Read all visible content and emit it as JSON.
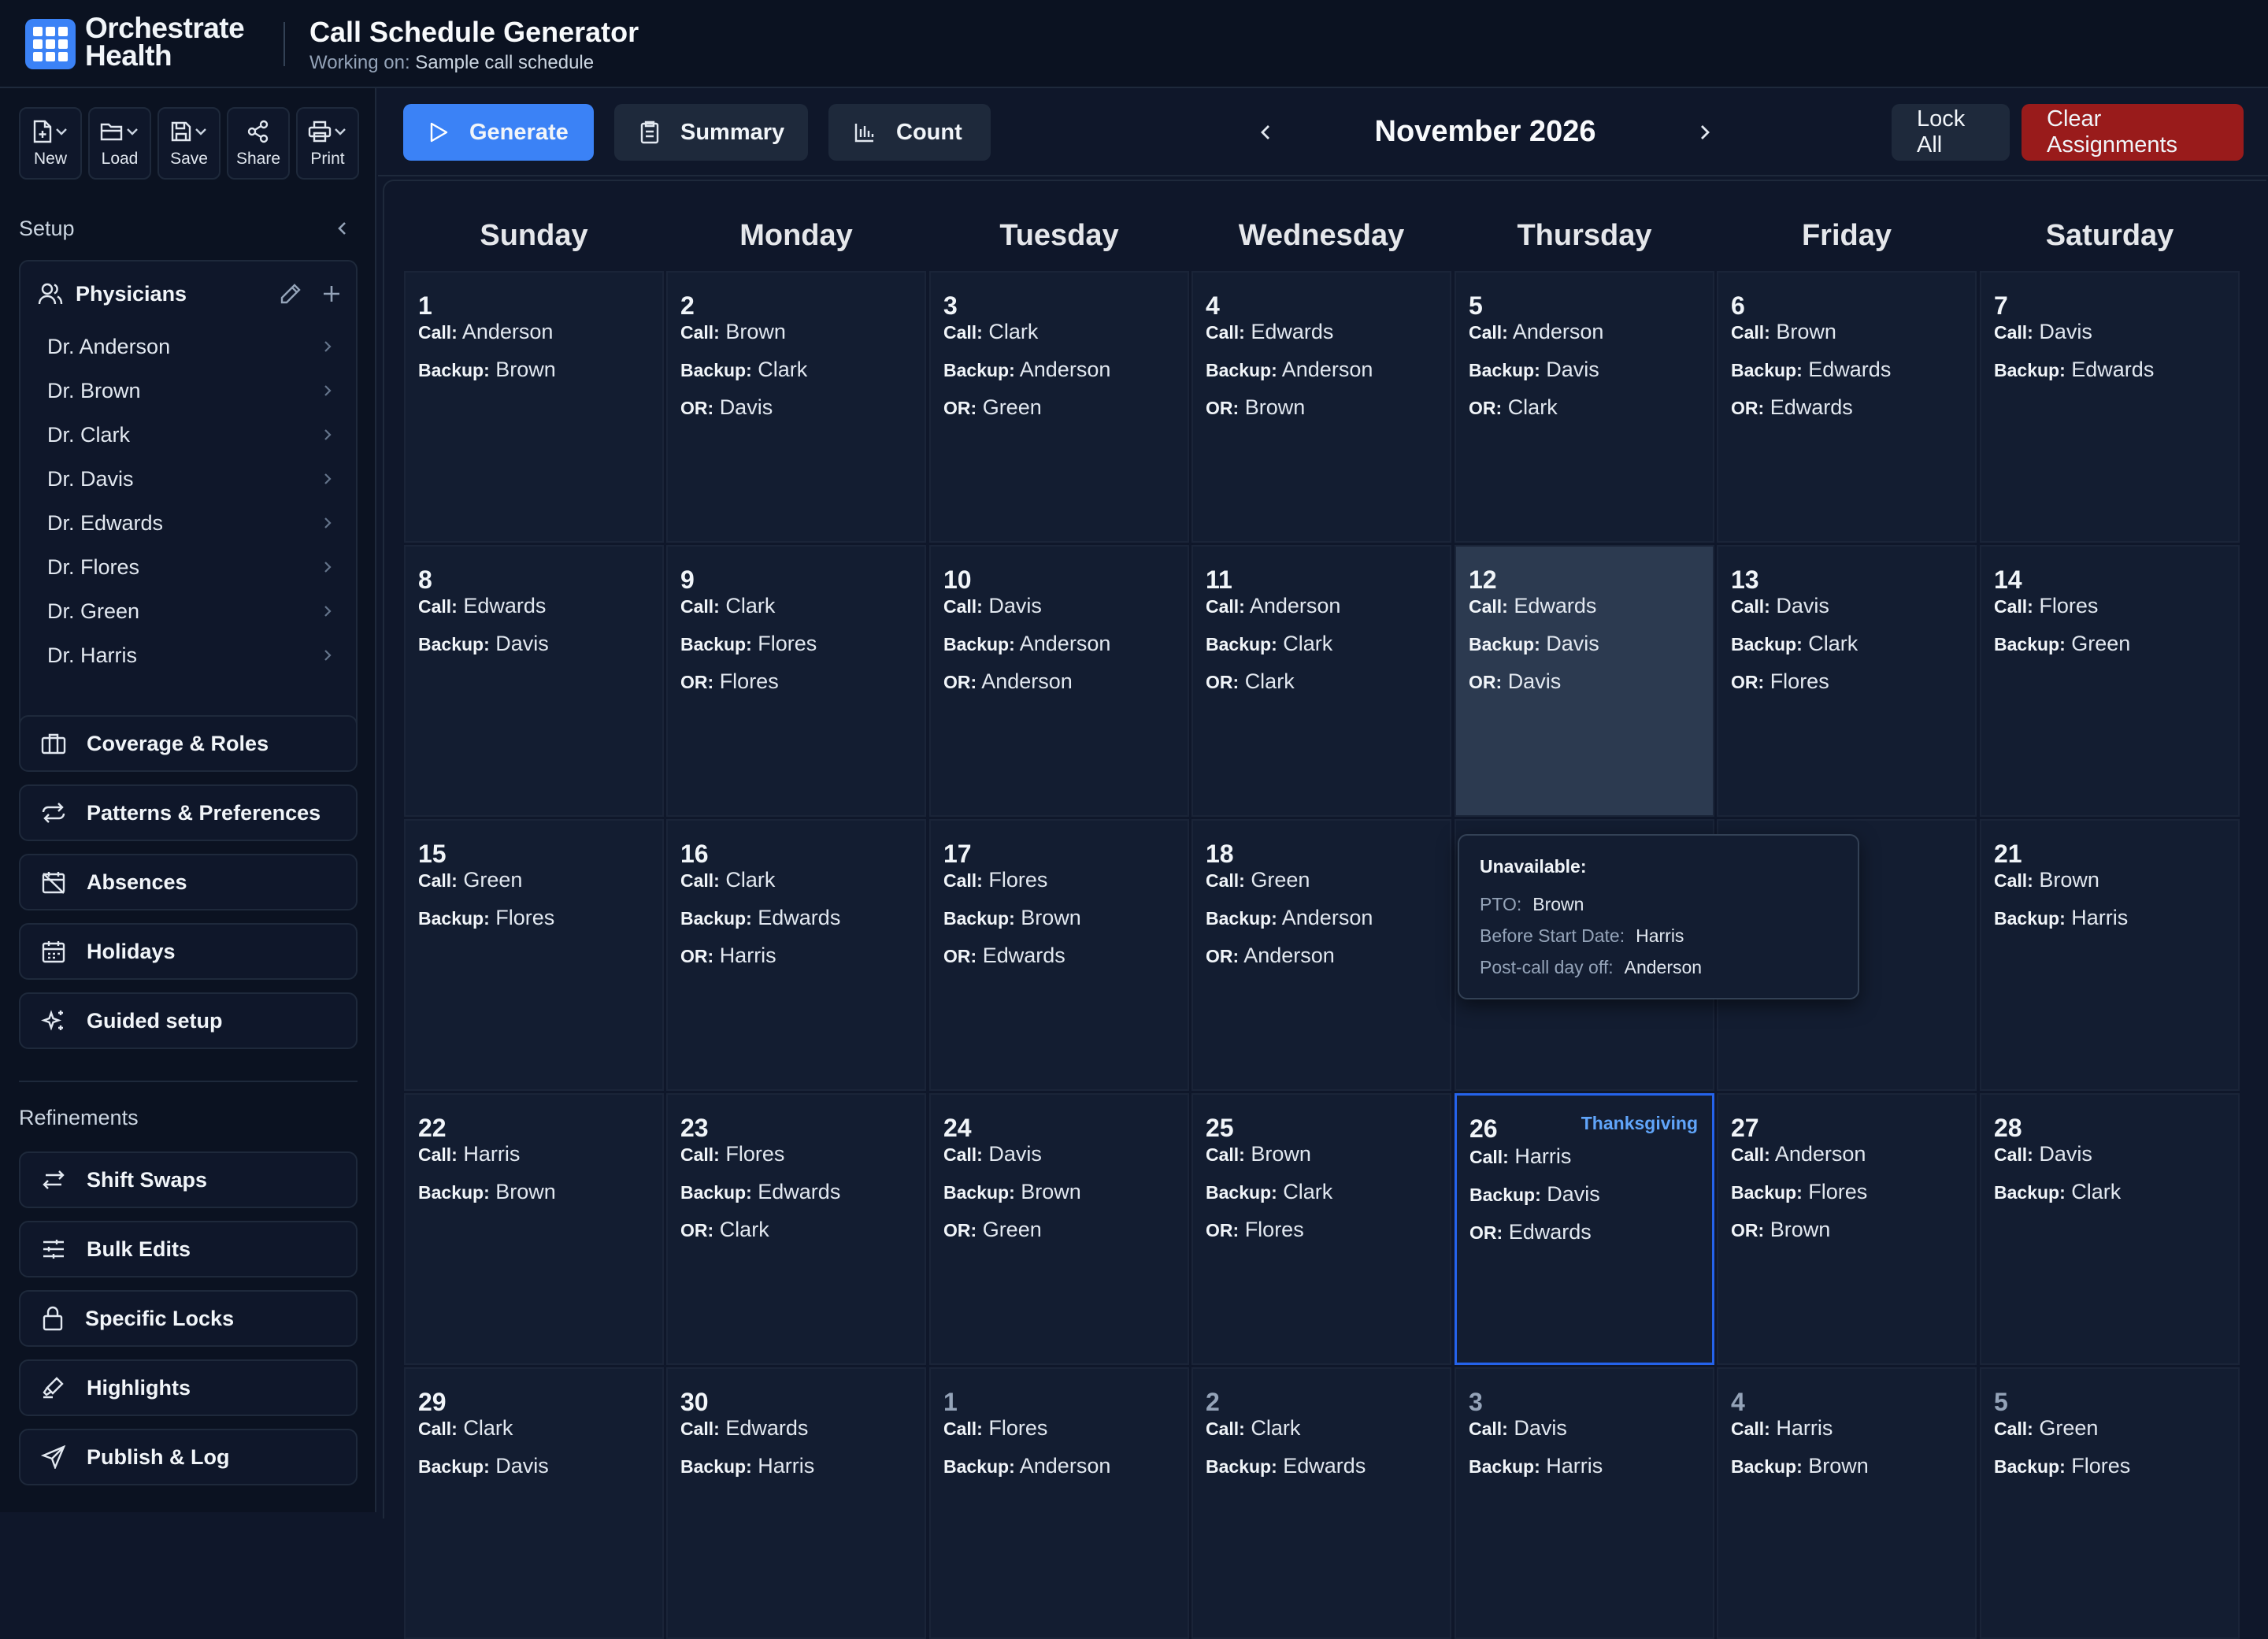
{
  "header": {
    "brand_line1": "Orchestrate",
    "brand_line2": "Health",
    "app_title": "Call Schedule Generator",
    "working_on_label": "Working on:",
    "working_on_value": "Sample call schedule"
  },
  "file_tools": [
    {
      "label": "New",
      "icon": "new-file-icon"
    },
    {
      "label": "Load",
      "icon": "folder-icon"
    },
    {
      "label": "Save",
      "icon": "save-icon"
    },
    {
      "label": "Share",
      "icon": "share-icon"
    },
    {
      "label": "Print",
      "icon": "printer-icon"
    }
  ],
  "sidebar": {
    "setup_label": "Setup",
    "physicians_title": "Physicians",
    "physicians": [
      "Dr. Anderson",
      "Dr. Brown",
      "Dr. Clark",
      "Dr. Davis",
      "Dr. Edwards",
      "Dr. Flores",
      "Dr. Green",
      "Dr. Harris"
    ],
    "setup_items": [
      {
        "label": "Coverage & Roles",
        "icon": "briefcase-icon"
      },
      {
        "label": "Patterns & Preferences",
        "icon": "repeat-icon"
      },
      {
        "label": "Absences",
        "icon": "calendar-off-icon"
      },
      {
        "label": "Holidays",
        "icon": "calendar-icon"
      },
      {
        "label": "Guided setup",
        "icon": "sparkles-icon"
      }
    ],
    "refinements_label": "Refinements",
    "refinement_items": [
      {
        "label": "Shift Swaps",
        "icon": "swap-icon"
      },
      {
        "label": "Bulk Edits",
        "icon": "sliders-icon"
      },
      {
        "label": "Specific Locks",
        "icon": "lock-icon"
      },
      {
        "label": "Highlights",
        "icon": "highlighter-icon"
      },
      {
        "label": "Publish & Log",
        "icon": "send-icon"
      }
    ]
  },
  "toolbar": {
    "generate_label": "Generate",
    "summary_label": "Summary",
    "count_label": "Count",
    "month_label": "November 2026",
    "lock_all_label": "Lock All",
    "clear_label": "Clear Assignments"
  },
  "colors": {
    "accent": "#3b82f6",
    "danger": "#991b1b",
    "holiday": "#60a5fa",
    "background": "#0f172a"
  },
  "calendar": {
    "weekdays": [
      "Sunday",
      "Monday",
      "Tuesday",
      "Wednesday",
      "Thursday",
      "Friday",
      "Saturday"
    ],
    "labels": {
      "call": "Call:",
      "backup": "Backup:",
      "or": "OR:"
    },
    "days": [
      {
        "num": "1",
        "call": "Anderson",
        "backup": "Brown"
      },
      {
        "num": "2",
        "call": "Brown",
        "backup": "Clark",
        "or": "Davis"
      },
      {
        "num": "3",
        "call": "Clark",
        "backup": "Anderson",
        "or": "Green"
      },
      {
        "num": "4",
        "call": "Edwards",
        "backup": "Anderson",
        "or": "Brown"
      },
      {
        "num": "5",
        "call": "Anderson",
        "backup": "Davis",
        "or": "Clark"
      },
      {
        "num": "6",
        "call": "Brown",
        "backup": "Edwards",
        "or": "Edwards"
      },
      {
        "num": "7",
        "call": "Davis",
        "backup": "Edwards"
      },
      {
        "num": "8",
        "call": "Edwards",
        "backup": "Davis"
      },
      {
        "num": "9",
        "call": "Clark",
        "backup": "Flores",
        "or": "Flores"
      },
      {
        "num": "10",
        "call": "Davis",
        "backup": "Anderson",
        "or": "Anderson"
      },
      {
        "num": "11",
        "call": "Anderson",
        "backup": "Clark",
        "or": "Clark"
      },
      {
        "num": "12",
        "call": "Edwards",
        "backup": "Davis",
        "or": "Davis",
        "highlight": true
      },
      {
        "num": "13",
        "call": "Davis",
        "backup": "Clark",
        "or": "Flores"
      },
      {
        "num": "14",
        "call": "Flores",
        "backup": "Green"
      },
      {
        "num": "15",
        "call": "Green",
        "backup": "Flores"
      },
      {
        "num": "16",
        "call": "Clark",
        "backup": "Edwards",
        "or": "Harris"
      },
      {
        "num": "17",
        "call": "Flores",
        "backup": "Brown",
        "or": "Edwards"
      },
      {
        "num": "18",
        "call": "Green",
        "backup": "Anderson",
        "or": "Anderson"
      },
      {
        "num": "",
        "hidden": true
      },
      {
        "num": "",
        "hidden": true
      },
      {
        "num": "21",
        "call": "Brown",
        "backup": "Harris"
      },
      {
        "num": "22",
        "call": "Harris",
        "backup": "Brown"
      },
      {
        "num": "23",
        "call": "Flores",
        "backup": "Edwards",
        "or": "Clark"
      },
      {
        "num": "24",
        "call": "Davis",
        "backup": "Brown",
        "or": "Green"
      },
      {
        "num": "25",
        "call": "Brown",
        "backup": "Clark",
        "or": "Flores"
      },
      {
        "num": "26",
        "call": "Harris",
        "backup": "Davis",
        "or": "Edwards",
        "today": true,
        "holiday": "Thanksgiving"
      },
      {
        "num": "27",
        "call": "Anderson",
        "backup": "Flores",
        "or": "Brown"
      },
      {
        "num": "28",
        "call": "Davis",
        "backup": "Clark"
      },
      {
        "num": "29",
        "call": "Clark",
        "backup": "Davis"
      },
      {
        "num": "30",
        "call": "Edwards",
        "backup": "Harris"
      },
      {
        "num": "1",
        "call": "Flores",
        "backup": "Anderson",
        "outside": true
      },
      {
        "num": "2",
        "call": "Clark",
        "backup": "Edwards",
        "outside": true
      },
      {
        "num": "3",
        "call": "Davis",
        "backup": "Harris",
        "outside": true
      },
      {
        "num": "4",
        "call": "Harris",
        "backup": "Brown",
        "outside": true
      },
      {
        "num": "5",
        "call": "Green",
        "backup": "Flores",
        "outside": true
      }
    ]
  },
  "tooltip": {
    "title": "Unavailable:",
    "rows": [
      {
        "label": "PTO:",
        "value": "Brown"
      },
      {
        "label": "Before Start Date:",
        "value": "Harris"
      },
      {
        "label": "Post-call day off:",
        "value": "Anderson"
      }
    ]
  }
}
